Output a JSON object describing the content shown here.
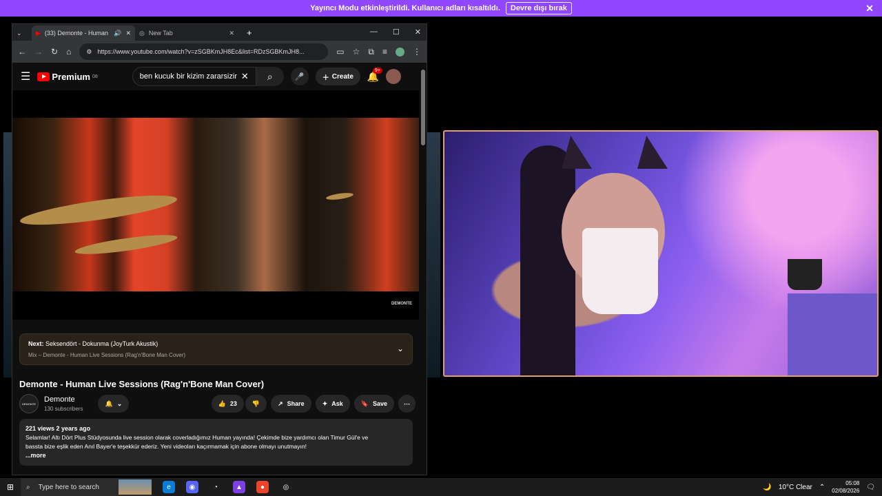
{
  "streamer_banner": {
    "message": "Yayıncı Modu etkinleştirildi. Kullanıcı adları kısaltıldı.",
    "button": "Devre dışı bırak",
    "close_icon": "✕"
  },
  "browser": {
    "tabs": [
      {
        "title": "(33) Demonte - Human Live",
        "active": true,
        "audio": true
      },
      {
        "title": "New Tab",
        "active": false
      }
    ],
    "url": "https://www.youtube.com/watch?v=zSGBKmJH8Ec&list=RDzSGBKmJH8...",
    "window_controls": [
      "—",
      "☐",
      "✕"
    ]
  },
  "youtube": {
    "logo_text": "Premium",
    "logo_sup": "08",
    "search_value": "ben kucuk bir kizim zararsizim",
    "create_label": "Create",
    "notif_badge": "9+",
    "video_brand": "DEMONTE",
    "next": {
      "prefix": "Next:",
      "title": "Seksendört - Dokunma (JoyTurk Akustik)",
      "mix": "Mix – Demonte - Human Live Sessions (Rag'n'Bone Man Cover)"
    },
    "video_title": "Demonte - Human Live Sessions (Rag'n'Bone Man Cover)",
    "channel": {
      "name": "Demonte",
      "subscribers": "130 subscribers",
      "avatar_text": "DEMONTE"
    },
    "actions": {
      "likes": "23",
      "share": "Share",
      "ask": "Ask",
      "save": "Save"
    },
    "description": {
      "meta": "221 views  2 years ago",
      "line1": "Selamlar! Altı Dört Plus Stüdyosunda live session olarak coverladığımız Human yayında! Çekimde bize yardımcı olan Timur Gül'e ve",
      "line2": "bassta bize eşlik eden Anıl Bayer'e teşekkür ederiz. Yeni videoları kaçırmamak için abone olmayı unutmayın!",
      "more": "...more"
    }
  },
  "taskbar": {
    "search_placeholder": "Type here to search",
    "weather": "10°C  Clear",
    "time": "05:08",
    "date": "02/08/2026"
  }
}
